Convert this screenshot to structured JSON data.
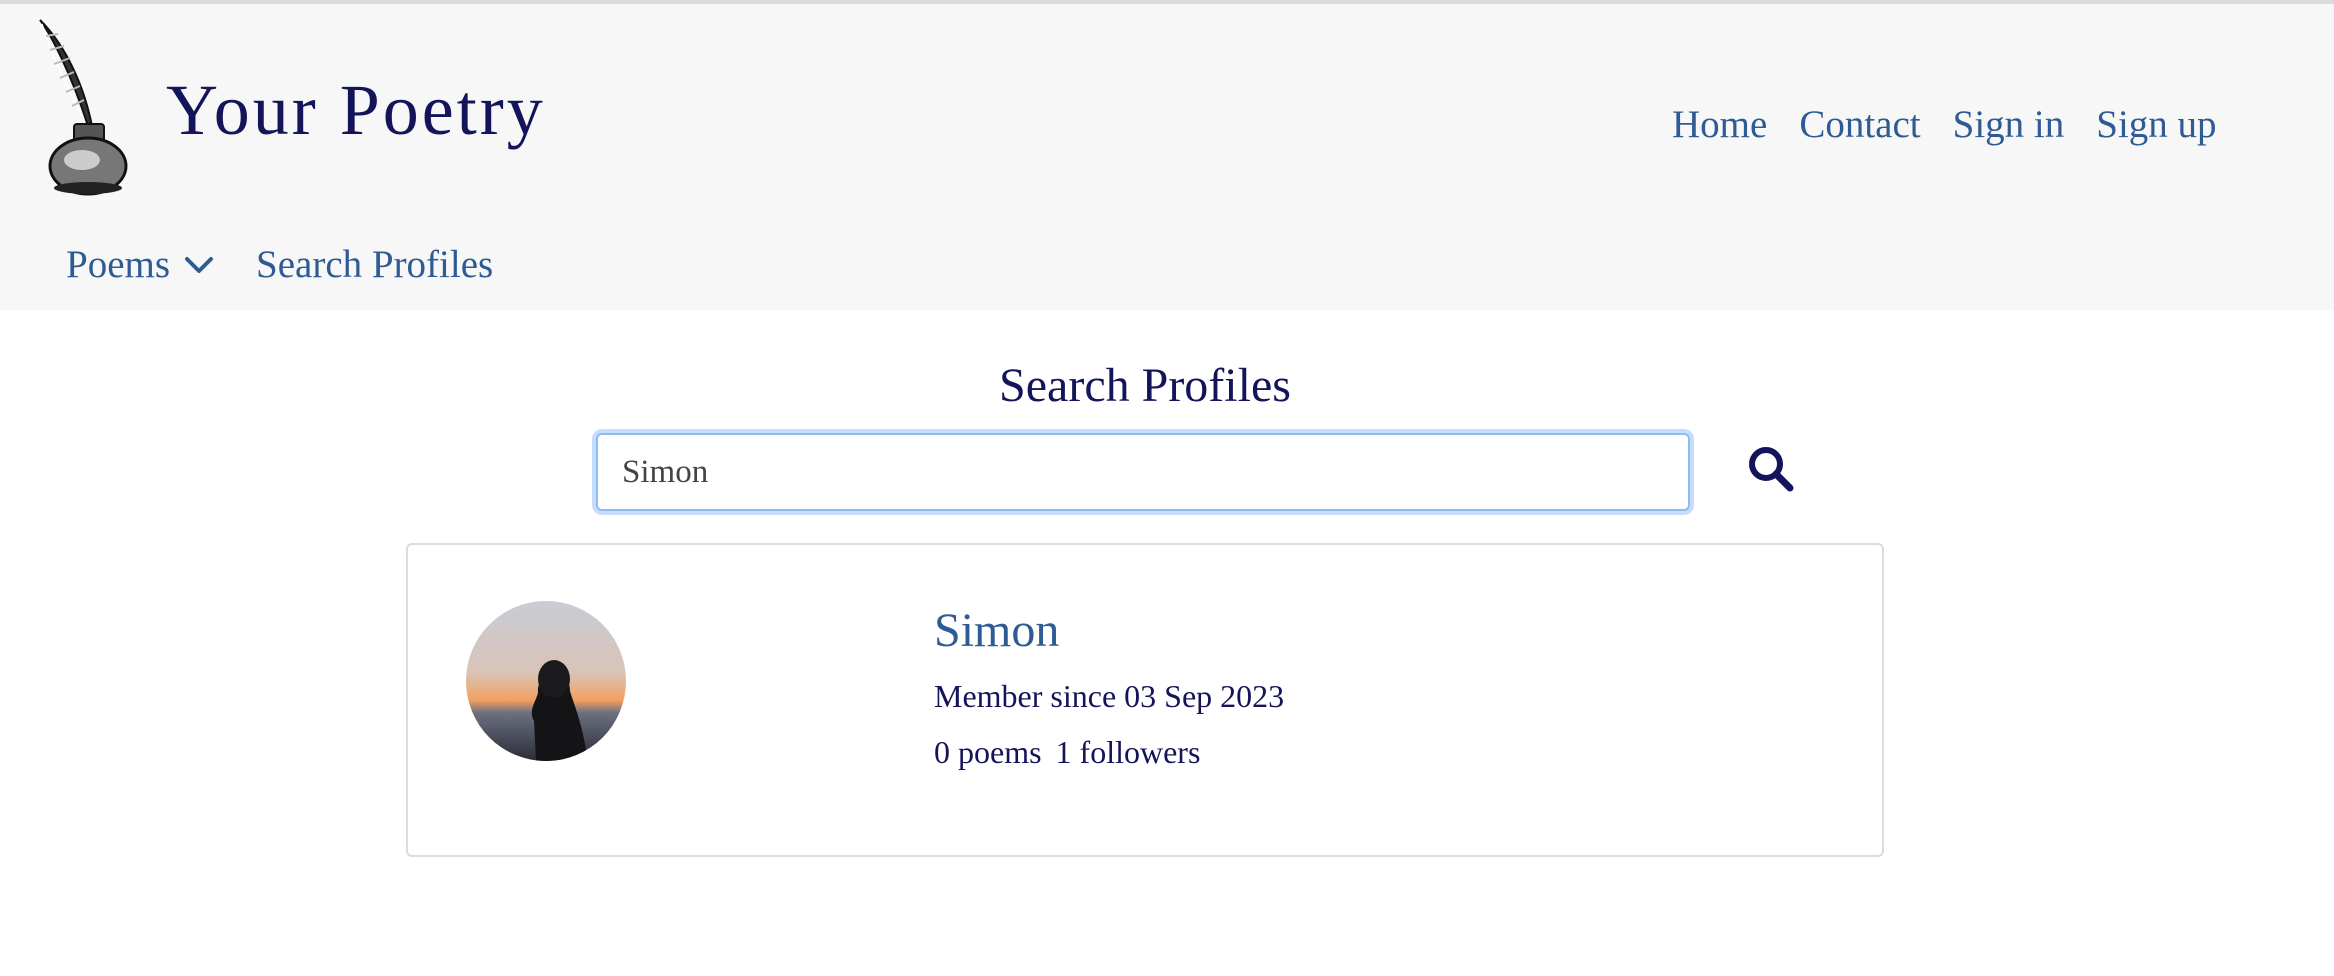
{
  "site": {
    "title": "Your Poetry"
  },
  "topnav": {
    "home": "Home",
    "contact": "Contact",
    "signin": "Sign in",
    "signup": "Sign up"
  },
  "subnav": {
    "poems": "Poems",
    "search_profiles": "Search Profiles"
  },
  "main": {
    "heading": "Search Profiles",
    "search_value": "Simon"
  },
  "results": [
    {
      "name": "Simon",
      "member_since": "Member since 03 Sep 2023",
      "poems": "0 poems",
      "followers": "1 followers"
    }
  ],
  "colors": {
    "title": "#14145a",
    "link": "#2f5b94",
    "header_bg": "#f7f7f7",
    "focus_ring": "#c6dcfb"
  },
  "icons": [
    "quill-inkwell-logo",
    "chevron-down-icon",
    "search-icon",
    "avatar-photo"
  ]
}
